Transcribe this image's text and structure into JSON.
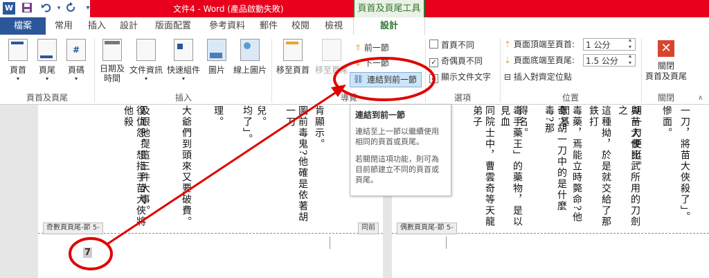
{
  "window": {
    "title": "文件4 - Word (產品啟動失敗)",
    "context_tab_group": "頁首及頁尾工具",
    "qat": {
      "save": "save-icon",
      "undo": "undo-icon",
      "redo": "redo-icon",
      "more": "▾"
    }
  },
  "tabs": [
    "檔案",
    "常用",
    "插入",
    "設計",
    "版面配置",
    "參考資料",
    "郵件",
    "校閱",
    "檢視",
    "設計"
  ],
  "ribbon": {
    "group_header_footer": {
      "label": "頁首及頁尾",
      "header": "頁首",
      "footer": "頁尾",
      "page_number": "頁碼"
    },
    "group_insert": {
      "label": "插入",
      "date_time": "日期及\n時間",
      "doc_info": "文件資訊",
      "quick_parts": "快速組件",
      "pictures": "圖片",
      "online_pictures": "線上圖片"
    },
    "group_navigation": {
      "label": "導覽",
      "goto_header": "移至頁首",
      "goto_footer": "移至頁尾",
      "previous": "前一節",
      "next": "下一節",
      "link_previous": "連結到前一節"
    },
    "group_options": {
      "label": "選項",
      "different_first": "首頁不同",
      "different_odd_even": "奇偶頁不同",
      "show_text": "顯示文件文字",
      "odd_even_checked": true
    },
    "group_position": {
      "label": "位置",
      "header_from_top_label": "頁面頂端至頁首:",
      "header_from_top": "1 公分",
      "footer_from_bottom_label": "頁面底端至頁尾:",
      "footer_from_bottom": "1.5 公分",
      "insert_align_tab": "插入對齊定位點"
    },
    "group_close": {
      "label": "關閉",
      "close": "關閉\n頁首及頁尾"
    }
  },
  "tooltip": {
    "title": "連結到前一節",
    "p1": "連結至上一節以繼續使用相同的頁首或頁尾。",
    "p2": "若關閉這項功能，則可為目前節建立不同的頁首或頁尾。"
  },
  "document": {
    "left_page": {
      "columns": [
        "復仇怨，想措手苗大俠將他殺",
        "及跟他提這三件大事。",
        "大爺們到頭來又要破費。",
        "理。",
        "兒。",
        "均了」。",
        "圖前毒鬼?他確是依著胡一刀",
        "肯顯示。"
      ],
      "footer_tag": "奇數頁頁尾-節 5-",
      "same_as_previous": "同前",
      "page_number": "7"
    },
    "right_page": {
      "columns": [
        "一刀，將苗大俠殺了」。",
        "慘面。",
        "胡一刀便挺。",
        "與苗大俠比武所用的刀劍之",
        "這種拗，於是就交給了那鉄打",
        "毒藥，焉能立時斃命?他閻基",
        "奇?胡一刀中的是什麼毒?那",
        "得名。",
        "毒手藥王」的藥物，是以見血",
        "同院士中，曹雲奇等天龍弟子"
      ],
      "footer_tag": "偶數頁頁尾-節 5-"
    }
  },
  "colors": {
    "title_bar": "#e8001c",
    "file_tab": "#2b579a",
    "context_tab": "#31752f",
    "annotation": "#e00000",
    "hover": "#cde6f7"
  }
}
